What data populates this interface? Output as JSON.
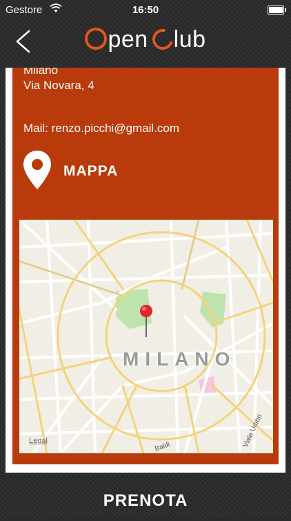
{
  "status_bar": {
    "carrier": "Gestore",
    "time": "16:50"
  },
  "header": {
    "logo_word_1": "pen",
    "logo_word_2": "lub"
  },
  "venue": {
    "city": "Milano",
    "address": "Via Novara, 4",
    "mail": "Mail: renzo.picchi@gmail.com"
  },
  "map_section": {
    "title": "MAPPA",
    "city_label": "MILANO",
    "legal_label": "Legal",
    "street_label_1": "Viale Umbri",
    "street_label_2": "Baldi"
  },
  "footer": {
    "book_label": "PRENOTA"
  },
  "colors": {
    "accent": "#e1561f",
    "card_bg": "#b93b0c",
    "park": "#bfe3ad",
    "road_major": "#f3d37b",
    "road_minor": "#ffffff"
  },
  "icons": {
    "back": "chevron-left-icon",
    "location": "location-pin-icon",
    "map_marker": "map-marker-icon"
  }
}
